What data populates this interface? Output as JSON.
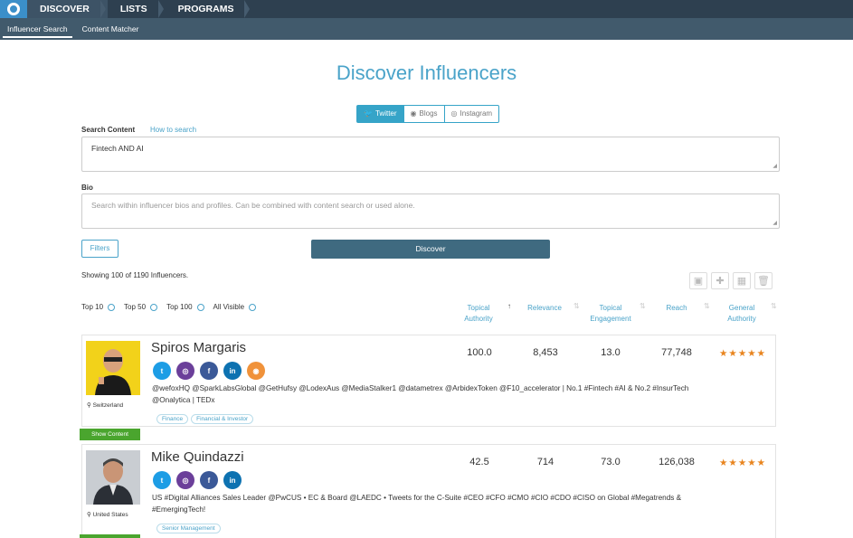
{
  "topnav": {
    "items": [
      {
        "label": "DISCOVER"
      },
      {
        "label": "LISTS"
      },
      {
        "label": "PROGRAMS"
      }
    ]
  },
  "subnav": {
    "items": [
      {
        "label": "Influencer Search"
      },
      {
        "label": "Content Matcher"
      }
    ]
  },
  "page": {
    "title": "Discover Influencers",
    "platforms": [
      {
        "label": "Twitter",
        "icon": "twitter-icon"
      },
      {
        "label": "Blogs",
        "icon": "rss-icon"
      },
      {
        "label": "Instagram",
        "icon": "instagram-icon"
      }
    ],
    "search": {
      "label": "Search Content",
      "how_to": "How to search",
      "value": "Fintech AND AI"
    },
    "bio": {
      "label": "Bio",
      "placeholder": "Search within influencer bios and profiles. Can be combined with content search or used alone."
    },
    "filters_label": "Filters",
    "discover_label": "Discover",
    "showing": "Showing 100 of 1190 Influencers.",
    "top_filters": [
      "Top 10",
      "Top 50",
      "Top 100",
      "All Visible"
    ],
    "columns": [
      {
        "line1": "Topical",
        "line2": "Authority"
      },
      {
        "line1": "Relevance",
        "line2": ""
      },
      {
        "line1": "Topical",
        "line2": "Engagement"
      },
      {
        "line1": "Reach",
        "line2": ""
      },
      {
        "line1": "General",
        "line2": "Authority"
      }
    ],
    "accent_color": "#4aa3c9",
    "nav_color": "#2e4050"
  },
  "influencers": [
    {
      "name": "Spiros Margaris",
      "location": "Switzerland",
      "bio": "@wefoxHQ @SparkLabsGlobal @GetHufsy @LodexAus @MediaStalker1 @datametrex @ArbidexToken @F10_accelerator | No.1 #Fintech #AI & No.2 #InsurTech @Onalytica | TEDx",
      "tags": [
        "Finance",
        "Financial & Investor"
      ],
      "topical_authority": "100.0",
      "relevance": "8,453",
      "topical_engagement": "13.0",
      "reach": "77,748",
      "general_authority_stars": "★★★★★",
      "show_content": "Show Content"
    },
    {
      "name": "Mike Quindazzi",
      "location": "United States",
      "bio": "US #Digital Alliances Sales Leader @PwCUS • EC & Board @LAEDC • Tweets for the C-Suite #CEO #CFO #CMO #CIO #CDO #CISO on Global #Megatrends & #EmergingTech!",
      "tags": [
        "Senior Management"
      ],
      "topical_authority": "42.5",
      "relevance": "714",
      "topical_engagement": "73.0",
      "reach": "126,038",
      "general_authority_stars": "★★★★★"
    }
  ]
}
